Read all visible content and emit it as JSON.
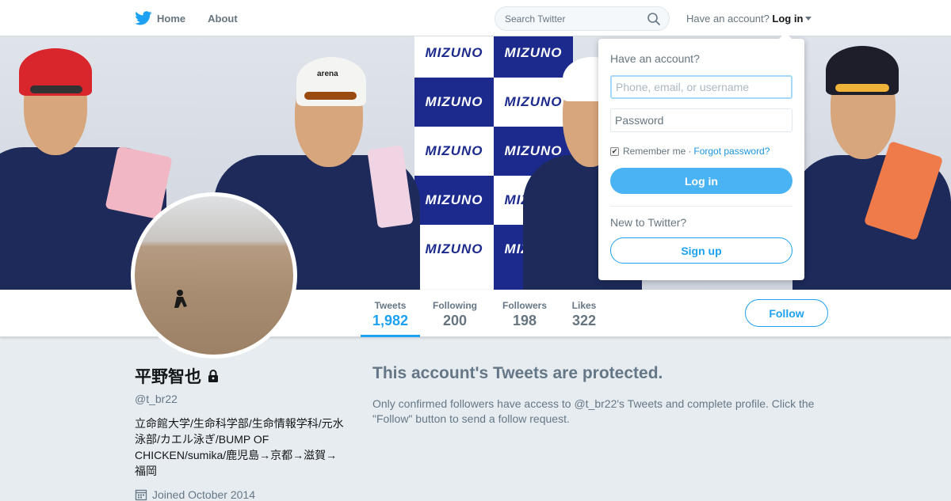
{
  "nav": {
    "home_label": "Home",
    "about_label": "About",
    "search_placeholder": "Search Twitter",
    "have_account_text": "Have an account?",
    "login_label": "Log in"
  },
  "banner": {
    "sponsor_text": "MIZUNO",
    "cap_text": "arena"
  },
  "profile_nav": {
    "stats": [
      {
        "label": "Tweets",
        "value": "1,982"
      },
      {
        "label": "Following",
        "value": "200"
      },
      {
        "label": "Followers",
        "value": "198"
      },
      {
        "label": "Likes",
        "value": "322"
      }
    ],
    "follow_label": "Follow"
  },
  "profile": {
    "display_name": "平野智也",
    "handle": "@t_br22",
    "bio": "立命館大学/生命科学部/生命情報学科/元水泳部/カエル泳ぎ/BUMP OF CHICKEN/sumika/鹿児島→京都→滋賀→福岡",
    "joined": "Joined October 2014"
  },
  "protected": {
    "title": "This account's Tweets are protected.",
    "message": "Only confirmed followers have access to @t_br22's Tweets and complete profile. Click the \"Follow\" button to send a follow request."
  },
  "login_dropdown": {
    "title": "Have an account?",
    "username_placeholder": "Phone, email, or username",
    "password_placeholder": "Password",
    "remember_label": "Remember me",
    "separator": "·",
    "forgot_label": "Forgot password?",
    "login_button": "Log in",
    "new_to": "New to Twitter?",
    "signup_button": "Sign up"
  },
  "colors": {
    "twitter_blue": "#1da1f2",
    "login_button_blue": "#4ab3f4",
    "page_bg": "#e6ecf0",
    "mizuno_navy": "#1b2a8c"
  }
}
